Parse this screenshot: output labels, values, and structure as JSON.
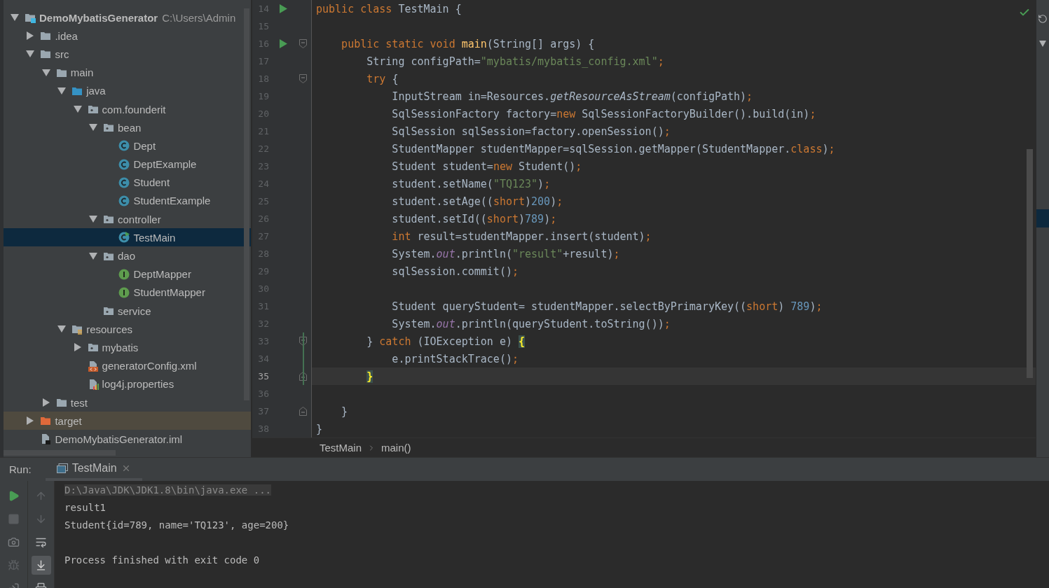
{
  "project_tree": {
    "items": [
      {
        "label": "DemoMybatisGenerator",
        "kind": "module",
        "hint": "C:\\Users\\Admin",
        "expanded": true,
        "selected": false,
        "children": [
          {
            "label": ".idea",
            "kind": "folder",
            "expanded": false,
            "selected": false
          },
          {
            "label": "src",
            "kind": "folder",
            "expanded": true,
            "selected": false,
            "children": [
              {
                "label": "main",
                "kind": "folder",
                "expanded": true,
                "selected": false,
                "children": [
                  {
                    "label": "java",
                    "kind": "source-root",
                    "expanded": true,
                    "selected": false,
                    "children": [
                      {
                        "label": "com.founderit",
                        "kind": "package",
                        "expanded": true,
                        "selected": false,
                        "children": [
                          {
                            "label": "bean",
                            "kind": "package",
                            "expanded": true,
                            "selected": false,
                            "children": [
                              {
                                "label": "Dept",
                                "kind": "class",
                                "selected": false
                              },
                              {
                                "label": "DeptExample",
                                "kind": "class",
                                "selected": false
                              },
                              {
                                "label": "Student",
                                "kind": "class",
                                "selected": false
                              },
                              {
                                "label": "StudentExample",
                                "kind": "class",
                                "selected": false
                              }
                            ]
                          },
                          {
                            "label": "controller",
                            "kind": "package",
                            "expanded": true,
                            "selected": false,
                            "children": [
                              {
                                "label": "TestMain",
                                "kind": "runnable-class",
                                "selected": true
                              }
                            ]
                          },
                          {
                            "label": "dao",
                            "kind": "package",
                            "expanded": true,
                            "selected": false,
                            "children": [
                              {
                                "label": "DeptMapper",
                                "kind": "interface",
                                "selected": false
                              },
                              {
                                "label": "StudentMapper",
                                "kind": "interface",
                                "selected": false
                              }
                            ]
                          },
                          {
                            "label": "service",
                            "kind": "package",
                            "selected": false
                          }
                        ]
                      }
                    ]
                  },
                  {
                    "label": "resources",
                    "kind": "resources-root",
                    "expanded": true,
                    "selected": false,
                    "children": [
                      {
                        "label": "mybatis",
                        "kind": "package",
                        "expanded": false,
                        "selected": false
                      },
                      {
                        "label": "generatorConfig.xml",
                        "kind": "xml",
                        "selected": false
                      },
                      {
                        "label": "log4j.properties",
                        "kind": "properties",
                        "selected": false
                      }
                    ]
                  }
                ]
              },
              {
                "label": "test",
                "kind": "folder",
                "expanded": false,
                "selected": false
              }
            ]
          },
          {
            "label": "target",
            "kind": "excluded",
            "expanded": false,
            "selected": false
          },
          {
            "label": "DemoMybatisGenerator.iml",
            "kind": "iml",
            "selected": false
          }
        ]
      }
    ]
  },
  "editor": {
    "lines": [
      {
        "number": "14",
        "run": true,
        "current": false,
        "code": [
          {
            "kind": "keyword",
            "text": "public class "
          },
          {
            "kind": "plain",
            "text": "TestMain {"
          }
        ]
      },
      {
        "number": "15",
        "current": false
      },
      {
        "number": "16",
        "run": true,
        "fold": {
          "kind": "start"
        },
        "current": false,
        "code": [
          {
            "kind": "keyword",
            "text": "    public static void "
          },
          {
            "kind": "method",
            "text": "main"
          },
          {
            "kind": "plain",
            "text": "(String[] args) {"
          }
        ]
      },
      {
        "number": "17",
        "current": false,
        "code": [
          {
            "kind": "plain",
            "text": "        String configPath="
          },
          {
            "kind": "string",
            "text": "\"mybatis/mybatis_config.xml\""
          },
          {
            "kind": "keyword",
            "text": ";"
          }
        ]
      },
      {
        "number": "18",
        "fold": {
          "kind": "start"
        },
        "current": false,
        "code": [
          {
            "kind": "keyword",
            "text": "        try "
          },
          {
            "kind": "plain",
            "text": "{"
          }
        ]
      },
      {
        "number": "19",
        "current": false,
        "code": [
          {
            "kind": "plain",
            "text": "            InputStream in=Resources."
          },
          {
            "kind": "static",
            "text": "getResourceAsStream"
          },
          {
            "kind": "plain",
            "text": "(configPath)"
          },
          {
            "kind": "keyword",
            "text": ";"
          }
        ]
      },
      {
        "number": "20",
        "current": false,
        "code": [
          {
            "kind": "plain",
            "text": "            SqlSessionFactory factory="
          },
          {
            "kind": "keyword",
            "text": "new "
          },
          {
            "kind": "plain",
            "text": "SqlSessionFactoryBuilder().build(in)"
          },
          {
            "kind": "keyword",
            "text": ";"
          }
        ]
      },
      {
        "number": "21",
        "current": false,
        "code": [
          {
            "kind": "plain",
            "text": "            SqlSession sqlSession=factory.openSession()"
          },
          {
            "kind": "keyword",
            "text": ";"
          }
        ]
      },
      {
        "number": "22",
        "current": false,
        "code": [
          {
            "kind": "plain",
            "text": "            StudentMapper studentMapper=sqlSession.getMapper(StudentMapper."
          },
          {
            "kind": "keyword",
            "text": "class"
          },
          {
            "kind": "plain",
            "text": ")"
          },
          {
            "kind": "keyword",
            "text": ";"
          }
        ]
      },
      {
        "number": "23",
        "current": false,
        "code": [
          {
            "kind": "plain",
            "text": "            Student student="
          },
          {
            "kind": "keyword",
            "text": "new "
          },
          {
            "kind": "plain",
            "text": "Student()"
          },
          {
            "kind": "keyword",
            "text": ";"
          }
        ]
      },
      {
        "number": "24",
        "current": false,
        "code": [
          {
            "kind": "plain",
            "text": "            student.setName("
          },
          {
            "kind": "string",
            "text": "\"TQ123\""
          },
          {
            "kind": "plain",
            "text": ")"
          },
          {
            "kind": "keyword",
            "text": ";"
          }
        ]
      },
      {
        "number": "25",
        "current": false,
        "code": [
          {
            "kind": "plain",
            "text": "            student.setAge(("
          },
          {
            "kind": "keyword",
            "text": "short"
          },
          {
            "kind": "plain",
            "text": ")"
          },
          {
            "kind": "number",
            "text": "200"
          },
          {
            "kind": "plain",
            "text": ")"
          },
          {
            "kind": "keyword",
            "text": ";"
          }
        ]
      },
      {
        "number": "26",
        "current": false,
        "code": [
          {
            "kind": "plain",
            "text": "            student.setId(("
          },
          {
            "kind": "keyword",
            "text": "short"
          },
          {
            "kind": "plain",
            "text": ")"
          },
          {
            "kind": "number",
            "text": "789"
          },
          {
            "kind": "plain",
            "text": ")"
          },
          {
            "kind": "keyword",
            "text": ";"
          }
        ]
      },
      {
        "number": "27",
        "current": false,
        "code": [
          {
            "kind": "keyword",
            "text": "            int "
          },
          {
            "kind": "plain",
            "text": "result=studentMapper.insert(student)"
          },
          {
            "kind": "keyword",
            "text": ";"
          }
        ]
      },
      {
        "number": "28",
        "current": false,
        "code": [
          {
            "kind": "plain",
            "text": "            System."
          },
          {
            "kind": "field",
            "text": "out"
          },
          {
            "kind": "plain",
            "text": ".println("
          },
          {
            "kind": "string",
            "text": "\"result\""
          },
          {
            "kind": "plain",
            "text": "+result)"
          },
          {
            "kind": "keyword",
            "text": ";"
          }
        ]
      },
      {
        "number": "29",
        "current": false,
        "code": [
          {
            "kind": "plain",
            "text": "            sqlSession.commit()"
          },
          {
            "kind": "keyword",
            "text": ";"
          }
        ]
      },
      {
        "number": "30",
        "current": false
      },
      {
        "number": "31",
        "current": false,
        "code": [
          {
            "kind": "plain",
            "text": "            Student queryStudent= studentMapper.selectByPrimaryKey(("
          },
          {
            "kind": "keyword",
            "text": "short"
          },
          {
            "kind": "plain",
            "text": ") "
          },
          {
            "kind": "number",
            "text": "789"
          },
          {
            "kind": "plain",
            "text": ")"
          },
          {
            "kind": "keyword",
            "text": ";"
          }
        ]
      },
      {
        "number": "32",
        "current": false,
        "code": [
          {
            "kind": "plain",
            "text": "            System."
          },
          {
            "kind": "field",
            "text": "out"
          },
          {
            "kind": "plain",
            "text": ".println(queryStudent.toString())"
          },
          {
            "kind": "keyword",
            "text": ";"
          }
        ]
      },
      {
        "number": "33",
        "fold": {
          "kind": "start"
        },
        "current": false,
        "changed": true,
        "code": [
          {
            "kind": "plain",
            "text": "        } "
          },
          {
            "kind": "keyword",
            "text": "catch "
          },
          {
            "kind": "plain",
            "text": "(IOException e) "
          },
          {
            "kind": "brace",
            "text": "{"
          }
        ]
      },
      {
        "number": "34",
        "current": false,
        "changed": true,
        "code": [
          {
            "kind": "plain",
            "text": "            e.printStackTrace()"
          },
          {
            "kind": "keyword",
            "text": ";"
          }
        ]
      },
      {
        "number": "35",
        "fold": {
          "kind": "end"
        },
        "current": true,
        "changed": true,
        "code": [
          {
            "kind": "brace",
            "text": "        }"
          }
        ]
      },
      {
        "number": "36",
        "current": false
      },
      {
        "number": "37",
        "fold": {
          "kind": "end"
        },
        "current": false,
        "code": [
          {
            "kind": "plain",
            "text": "    }"
          }
        ]
      },
      {
        "number": "38",
        "current": false,
        "code": [
          {
            "kind": "plain",
            "text": "}"
          }
        ]
      }
    ],
    "breadcrumbs": [
      "TestMain",
      "main()"
    ]
  },
  "run_panel": {
    "label": "Run:",
    "tabs": [
      {
        "label": "TestMain",
        "selected": true
      }
    ],
    "run_actions": [
      {
        "kind": "rerun",
        "disabled": false
      },
      {
        "kind": "stop",
        "disabled": true
      },
      {
        "kind": "camera",
        "disabled": false
      },
      {
        "kind": "bug",
        "disabled": true
      },
      {
        "kind": "login",
        "disabled": false
      }
    ],
    "console_actions": [
      {
        "kind": "up",
        "selected": false
      },
      {
        "kind": "down",
        "selected": false
      },
      {
        "kind": "wrap",
        "selected": false
      },
      {
        "kind": "scroll-end",
        "selected": true
      },
      {
        "kind": "print",
        "selected": false
      }
    ],
    "console": [
      {
        "kind": "command",
        "text": "D:\\Java\\JDK\\JDK1.8\\bin\\java.exe ..."
      },
      {
        "kind": "output",
        "text": "result1"
      },
      {
        "kind": "output",
        "text": "Student{id=789, name='TQ123', age=200}"
      },
      {
        "kind": "exit",
        "text": "Process finished with exit code 0"
      }
    ]
  }
}
